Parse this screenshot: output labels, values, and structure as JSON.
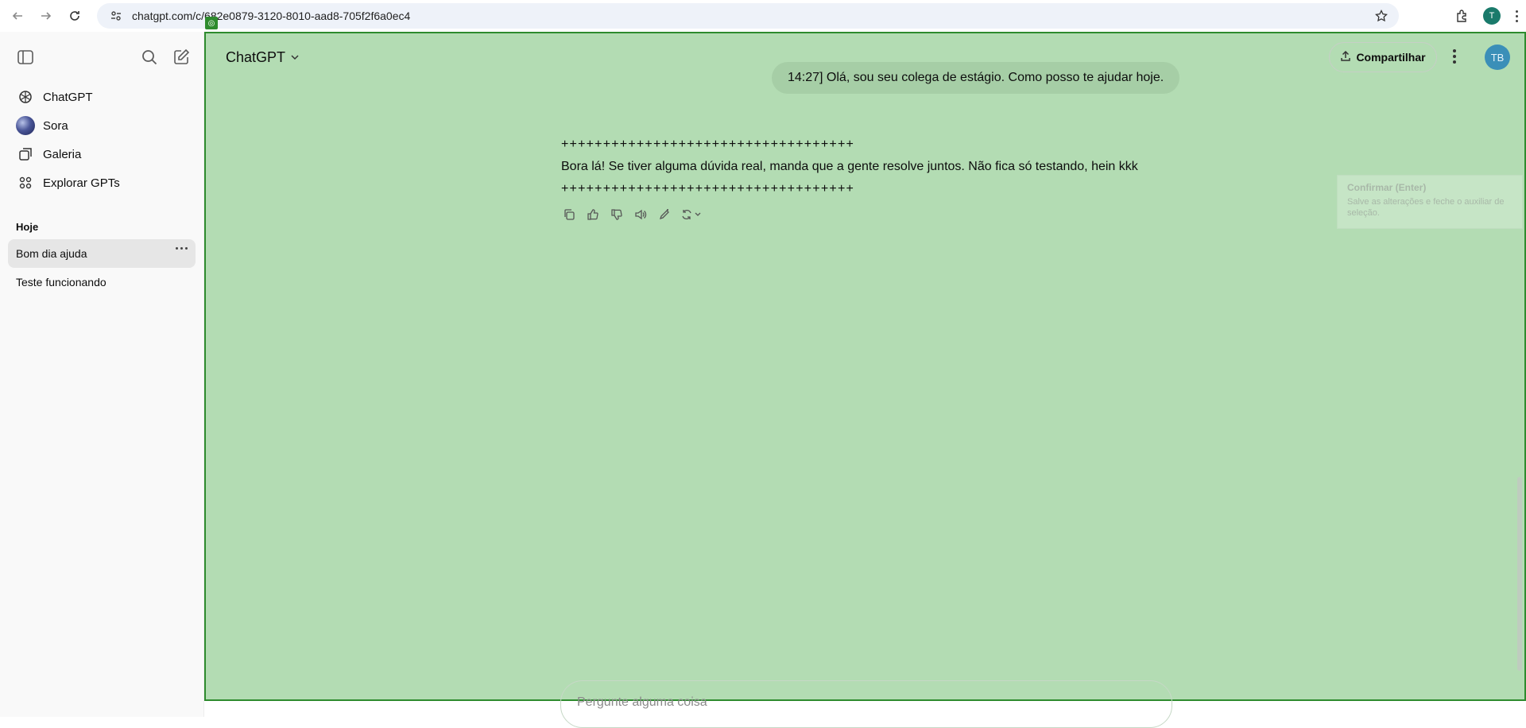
{
  "browser": {
    "url": "chatgpt.com/c/682e0879-3120-8010-aad8-705f2f6a0ec4",
    "profile_initial": "T"
  },
  "sidebar": {
    "items": [
      {
        "label": "ChatGPT",
        "icon": "chatgpt-logo-icon"
      },
      {
        "label": "Sora",
        "icon": "sora-ball-icon"
      },
      {
        "label": "Galeria",
        "icon": "gallery-icon"
      },
      {
        "label": "Explorar GPTs",
        "icon": "grid-icon"
      }
    ],
    "section_today": "Hoje",
    "chats": [
      {
        "label": "Bom dia ajuda",
        "active": true
      },
      {
        "label": "Teste funcionando",
        "active": false
      }
    ]
  },
  "header": {
    "model_label": "ChatGPT",
    "share_label": "Compartilhar",
    "avatar_initials": "TB"
  },
  "conversation": {
    "user_message": "14:27] Olá, sou seu colega de estágio. Como posso te ajudar hoje.",
    "assistant_separator_top": "+++++++++++++++++++++++++++++++++++",
    "assistant_text": "Bora lá! Se tiver alguma dúvida real, manda que a gente resolve juntos. Não fica só testando, hein kkk",
    "assistant_separator_bottom": "+++++++++++++++++++++++++++++++++++"
  },
  "tooltip": {
    "title": "Confirmar (Enter)",
    "body": "Salve as alterações e feche o auxiliar de seleção."
  },
  "composer": {
    "placeholder": "Pergunte alguma coisa"
  },
  "colors": {
    "overlay": "#b3dcb3",
    "overlay_border": "#2e8b2e",
    "avatar": "#3b8fb8"
  }
}
